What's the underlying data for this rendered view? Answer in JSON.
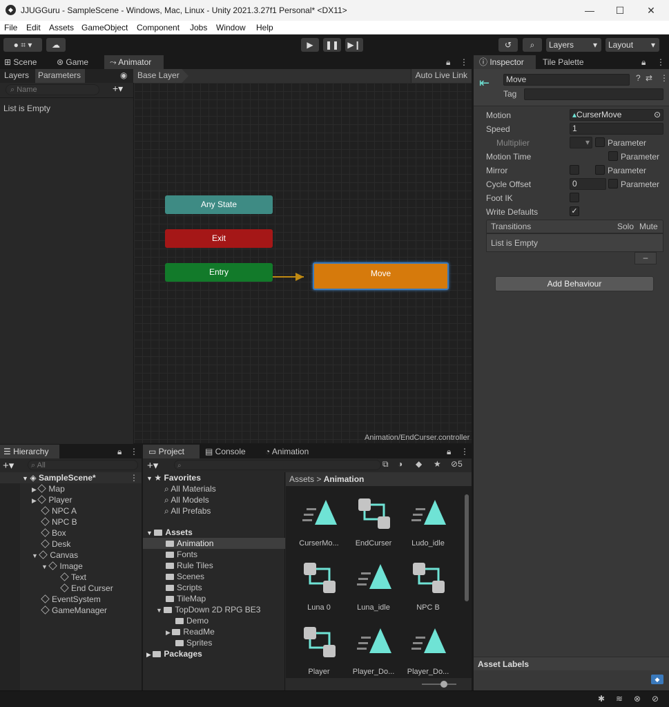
{
  "window": {
    "title": "JJUGGuru - SampleScene - Windows, Mac, Linux - Unity 2021.3.27f1 Personal* <DX11>",
    "minimize": "—",
    "maximize": "☐",
    "close": "✕"
  },
  "menu": [
    "File",
    "Edit",
    "Assets",
    "GameObject",
    "Component",
    "Jobs",
    "Window",
    "Help"
  ],
  "toolbar": {
    "layers": "Layers",
    "layout": "Layout"
  },
  "scene_tabs": {
    "scene": "Scene",
    "game": "Game",
    "animator": "Animator"
  },
  "animator": {
    "sub_tabs": {
      "layers": "Layers",
      "parameters": "Parameters"
    },
    "search_placeholder": "Name",
    "list_empty": "List is Empty",
    "breadcrumb": "Base Layer",
    "auto_live_link": "Auto Live Link",
    "nodes": {
      "any_state": "Any State",
      "exit": "Exit",
      "entry": "Entry",
      "move": "Move"
    },
    "status_path": "Animation/EndCurser.controller"
  },
  "inspector": {
    "tabs": {
      "inspector": "Inspector",
      "tile_palette": "Tile Palette"
    },
    "name": "Move",
    "tag_label": "Tag",
    "motion_label": "Motion",
    "motion_value": "CurserMove",
    "speed_label": "Speed",
    "speed_value": "1",
    "multiplier_label": "Multiplier",
    "parameter_label": "Parameter",
    "motion_time_label": "Motion Time",
    "mirror_label": "Mirror",
    "cycle_offset_label": "Cycle Offset",
    "cycle_offset_value": "0",
    "foot_ik_label": "Foot IK",
    "write_defaults_label": "Write Defaults",
    "transitions": {
      "title": "Transitions",
      "solo": "Solo",
      "mute": "Mute",
      "empty": "List is Empty",
      "remove": "–"
    },
    "add_behaviour": "Add Behaviour",
    "asset_labels": "Asset Labels"
  },
  "hierarchy": {
    "tab": "Hierarchy",
    "search_placeholder": "All",
    "scene": "SampleScene*",
    "items": [
      "Map",
      "Player",
      "NPC A",
      "NPC B",
      "Box",
      "Desk",
      "Canvas",
      "Image",
      "Text",
      "End Curser",
      "EventSystem",
      "GameManager"
    ]
  },
  "project": {
    "tabs": {
      "project": "Project",
      "console": "Console",
      "animation": "Animation"
    },
    "hidden_count": "5",
    "favorites": {
      "title": "Favorites",
      "items": [
        "All Materials",
        "All Models",
        "All Prefabs"
      ]
    },
    "assets": {
      "title": "Assets",
      "items": [
        "Animation",
        "Fonts",
        "Rule Tiles",
        "Scenes",
        "Scripts",
        "TileMap",
        "TopDown 2D RPG BE3",
        "Demo",
        "ReadMe",
        "Sprites"
      ]
    },
    "packages": "Packages",
    "breadcrumb": {
      "root": "Assets",
      "sep": ">",
      "current": "Animation"
    },
    "grid": [
      {
        "name": "CurserMo...",
        "kind": "clip"
      },
      {
        "name": "EndCurser",
        "kind": "controller"
      },
      {
        "name": "Ludo_idle",
        "kind": "clip"
      },
      {
        "name": "Luna 0",
        "kind": "controller"
      },
      {
        "name": "Luna_idle",
        "kind": "clip"
      },
      {
        "name": "NPC B",
        "kind": "controller"
      },
      {
        "name": "Player",
        "kind": "controller"
      },
      {
        "name": "Player_Do...",
        "kind": "clip"
      },
      {
        "name": "Player_Do...",
        "kind": "clip"
      }
    ]
  },
  "colors": {
    "any_state": "#3e8b84",
    "exit": "#a51717",
    "entry": "#127a2a",
    "move": "#d67a0c",
    "selected": "#3a79bb",
    "icon": "#6fe3d5"
  }
}
